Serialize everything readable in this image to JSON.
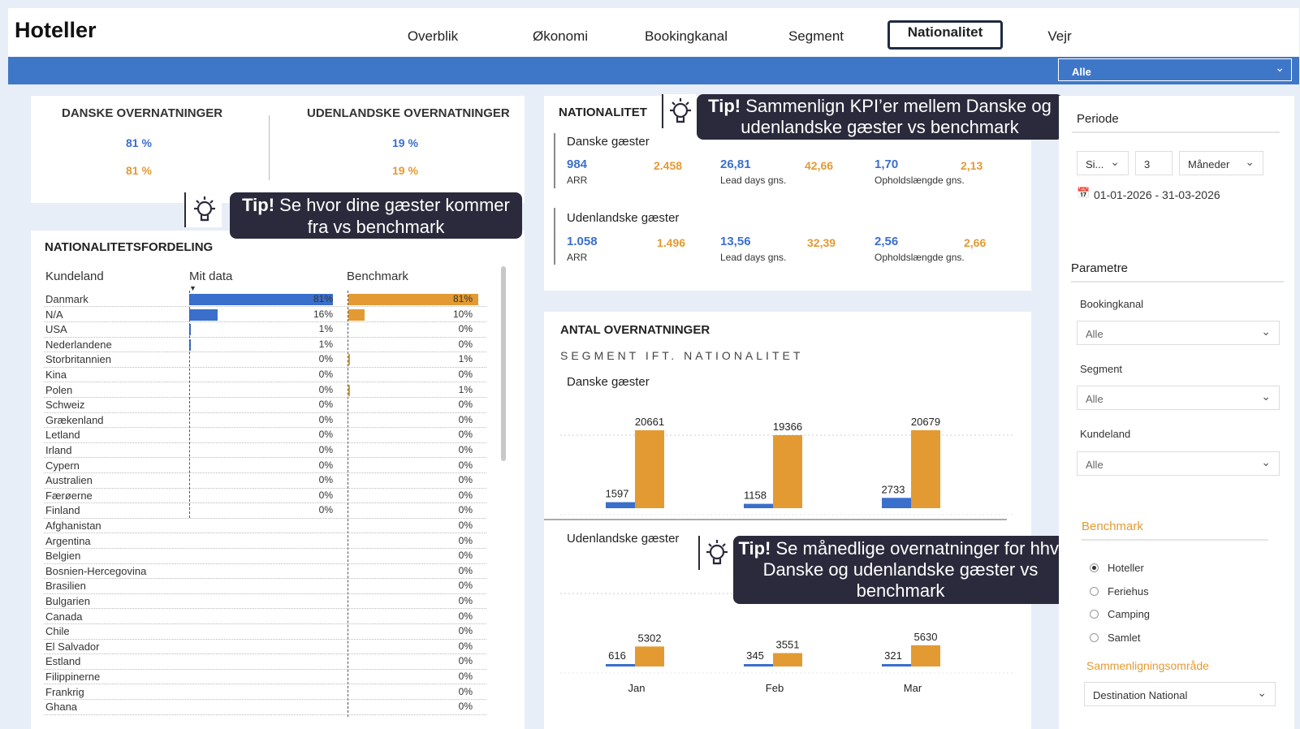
{
  "app": {
    "title": "Hoteller"
  },
  "tabs": [
    {
      "label": "Overblik",
      "active": false
    },
    {
      "label": "Økonomi",
      "active": false
    },
    {
      "label": "Bookingkanal",
      "active": false
    },
    {
      "label": "Segment",
      "active": false
    },
    {
      "label": "Nationalitet",
      "active": true
    },
    {
      "label": "Vejr",
      "active": false
    }
  ],
  "top_filter": {
    "value": "Alle"
  },
  "kpis": {
    "danske": {
      "title": "DANSKE OVERNATNINGER",
      "mine": "81 %",
      "bench": "81 %"
    },
    "udenlandske": {
      "title": "UDENLANDSKE OVERNATNINGER",
      "mine": "19 %",
      "bench": "19 %"
    }
  },
  "tips": {
    "tip1": {
      "bold": "Tip!",
      "text": " Se hvor dine gæster kommer fra vs benchmark"
    },
    "tip2": {
      "bold": "Tip!",
      "text": " Sammenlign KPI’er mellem Danske og udenlandske gæster vs benchmark"
    },
    "tip3": {
      "bold": "Tip!",
      "text": " Se månedlige overnatninger for hhv. Danske og udenlandske gæster vs benchmark"
    }
  },
  "nationality_table": {
    "title": "NATIONALITETSFORDELING",
    "col_country": "Kundeland",
    "col_mine": "Mit data",
    "col_bench": "Benchmark",
    "rows": [
      {
        "country": "Danmark",
        "mine": "81%",
        "bench": "81%",
        "mine_frac": 0.81,
        "bench_frac": 0.81
      },
      {
        "country": "N/A",
        "mine": "16%",
        "bench": "10%",
        "mine_frac": 0.16,
        "bench_frac": 0.1
      },
      {
        "country": "USA",
        "mine": "1%",
        "bench": "0%",
        "mine_frac": 0.01,
        "bench_frac": 0
      },
      {
        "country": "Nederlandene",
        "mine": "1%",
        "bench": "0%",
        "mine_frac": 0.01,
        "bench_frac": 0
      },
      {
        "country": "Storbritannien",
        "mine": "0%",
        "bench": "1%",
        "mine_frac": 0,
        "bench_frac": 0.01
      },
      {
        "country": "Kina",
        "mine": "0%",
        "bench": "0%",
        "mine_frac": 0,
        "bench_frac": 0
      },
      {
        "country": "Polen",
        "mine": "0%",
        "bench": "1%",
        "mine_frac": 0,
        "bench_frac": 0.01
      },
      {
        "country": "Schweiz",
        "mine": "0%",
        "bench": "0%",
        "mine_frac": 0,
        "bench_frac": 0
      },
      {
        "country": "Grækenland",
        "mine": "0%",
        "bench": "0%",
        "mine_frac": 0,
        "bench_frac": 0
      },
      {
        "country": "Letland",
        "mine": "0%",
        "bench": "0%",
        "mine_frac": 0,
        "bench_frac": 0
      },
      {
        "country": "Irland",
        "mine": "0%",
        "bench": "0%",
        "mine_frac": 0,
        "bench_frac": 0
      },
      {
        "country": "Cypern",
        "mine": "0%",
        "bench": "0%",
        "mine_frac": 0,
        "bench_frac": 0
      },
      {
        "country": "Australien",
        "mine": "0%",
        "bench": "0%",
        "mine_frac": 0,
        "bench_frac": 0
      },
      {
        "country": "Færøerne",
        "mine": "0%",
        "bench": "0%",
        "mine_frac": 0,
        "bench_frac": 0
      },
      {
        "country": "Finland",
        "mine": "0%",
        "bench": "0%",
        "mine_frac": 0,
        "bench_frac": 0
      },
      {
        "country": "Afghanistan",
        "mine": "",
        "bench": "0%",
        "mine_frac": 0,
        "bench_frac": 0
      },
      {
        "country": "Argentina",
        "mine": "",
        "bench": "0%",
        "mine_frac": 0,
        "bench_frac": 0
      },
      {
        "country": "Belgien",
        "mine": "",
        "bench": "0%",
        "mine_frac": 0,
        "bench_frac": 0
      },
      {
        "country": "Bosnien-Hercegovina",
        "mine": "",
        "bench": "0%",
        "mine_frac": 0,
        "bench_frac": 0
      },
      {
        "country": "Brasilien",
        "mine": "",
        "bench": "0%",
        "mine_frac": 0,
        "bench_frac": 0
      },
      {
        "country": "Bulgarien",
        "mine": "",
        "bench": "0%",
        "mine_frac": 0,
        "bench_frac": 0
      },
      {
        "country": "Canada",
        "mine": "",
        "bench": "0%",
        "mine_frac": 0,
        "bench_frac": 0
      },
      {
        "country": "Chile",
        "mine": "",
        "bench": "0%",
        "mine_frac": 0,
        "bench_frac": 0
      },
      {
        "country": "El Salvador",
        "mine": "",
        "bench": "0%",
        "mine_frac": 0,
        "bench_frac": 0
      },
      {
        "country": "Estland",
        "mine": "",
        "bench": "0%",
        "mine_frac": 0,
        "bench_frac": 0
      },
      {
        "country": "Filippinerne",
        "mine": "",
        "bench": "0%",
        "mine_frac": 0,
        "bench_frac": 0
      },
      {
        "country": "Frankrig",
        "mine": "",
        "bench": "0%",
        "mine_frac": 0,
        "bench_frac": 0
      },
      {
        "country": "Ghana",
        "mine": "",
        "bench": "0%",
        "mine_frac": 0,
        "bench_frac": 0
      }
    ]
  },
  "nationalitet_kpis": {
    "title": "NATIONALITET",
    "danske": {
      "label": "Danske gæster",
      "arr": {
        "mine": "984",
        "bench": "2.458",
        "label": "ARR"
      },
      "lead": {
        "mine": "26,81",
        "bench": "42,66",
        "label": "Lead days gns."
      },
      "stay": {
        "mine": "1,70",
        "bench": "2,13",
        "label": "Opholdslængde gns."
      }
    },
    "udenlandske": {
      "label": "Udenlandske gæster",
      "arr": {
        "mine": "1.058",
        "bench": "1.496",
        "label": "ARR"
      },
      "lead": {
        "mine": "13,56",
        "bench": "32,39",
        "label": "Lead days gns."
      },
      "stay": {
        "mine": "2,56",
        "bench": "2,66",
        "label": "Opholdslængde gns."
      }
    }
  },
  "overnight_chart": {
    "title": "ANTAL OVERNATNINGER",
    "subtitle": "SEGMENT IFT. NATIONALITET",
    "section_danske": "Danske gæster",
    "section_udenlandske": "Udenlandske gæster"
  },
  "chart_data": [
    {
      "type": "bar",
      "title": "Danske gæster",
      "categories": [
        "Jan",
        "Feb",
        "Mar"
      ],
      "series": [
        {
          "name": "",
          "color": "#3a6fcc",
          "values": [
            1597,
            1158,
            2733
          ]
        },
        {
          "name": "",
          "color": "#e39a33",
          "values": [
            20661,
            19366,
            20679
          ]
        }
      ],
      "ylim": [
        0,
        22000
      ]
    },
    {
      "type": "bar",
      "title": "Udenlandske gæster",
      "categories": [
        "Jan",
        "Feb",
        "Mar"
      ],
      "series": [
        {
          "name": "",
          "color": "#3a6fcc",
          "values": [
            616,
            345,
            321
          ]
        },
        {
          "name": "",
          "color": "#e39a33",
          "values": [
            5302,
            3551,
            5630
          ]
        }
      ],
      "ylim": [
        0,
        22000
      ]
    }
  ],
  "sidebar": {
    "periode_label": "Periode",
    "period_type": "Si...",
    "period_count": "3",
    "period_unit": "Måneder",
    "date_range": "01-01-2026 - 31-03-2026",
    "parametre_label": "Parametre",
    "bookingkanal": {
      "label": "Bookingkanal",
      "value": "Alle"
    },
    "segment": {
      "label": "Segment",
      "value": "Alle"
    },
    "kundeland": {
      "label": "Kundeland",
      "value": "Alle"
    },
    "benchmark_label": "Benchmark",
    "benchmark_options": [
      {
        "label": "Hoteller",
        "selected": true
      },
      {
        "label": "Feriehus",
        "selected": false
      },
      {
        "label": "Camping",
        "selected": false
      },
      {
        "label": "Samlet",
        "selected": false
      }
    ],
    "comparison_label": "Sammenligningsområde",
    "comparison_value": "Destination National"
  },
  "colors": {
    "blue": "#3a6fcc",
    "orange": "#e39a33",
    "bar": "#3f77c8",
    "tip_bg": "#2a2a3c"
  },
  "icons": {
    "tip": "lightbulb-icon",
    "dropdown": "chevron-down-icon",
    "calendar": "calendar-icon"
  }
}
